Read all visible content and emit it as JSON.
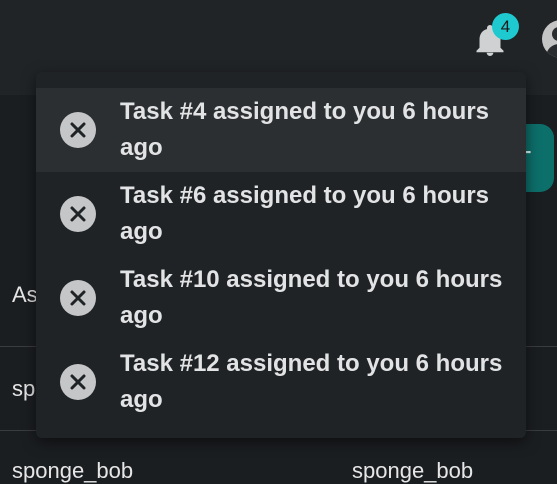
{
  "header": {
    "notification_count": "4",
    "bell_icon": "bell-icon",
    "avatar_icon": "user-avatar-icon"
  },
  "background": {
    "column_header": "As",
    "rows": [
      "sp",
      "sponge_bob",
      "sponge_bob"
    ],
    "add_button_label": "+"
  },
  "notifications": [
    {
      "text": "Task #4 assigned to you 6 hours ago",
      "close_icon": "close-icon"
    },
    {
      "text": "Task #6 assigned to you 6 hours ago",
      "close_icon": "close-icon"
    },
    {
      "text": "Task #10 assigned to you 6 hours ago",
      "close_icon": "close-icon"
    },
    {
      "text": "Task #12 assigned to you 6 hours ago",
      "close_icon": "close-icon"
    }
  ],
  "colors": {
    "badge": "#1ec9cf",
    "accent": "#0d6f6a",
    "panel": "#202326",
    "hover": "#2c2f32"
  }
}
